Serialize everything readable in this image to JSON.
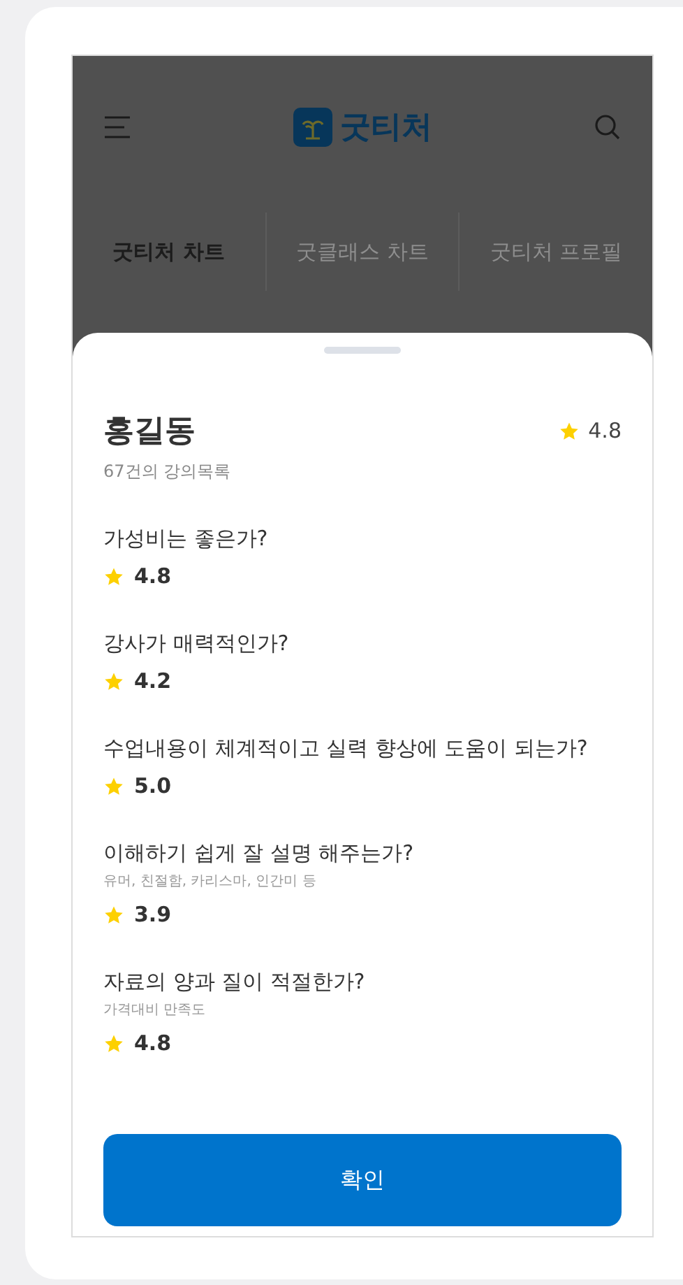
{
  "header": {
    "logo_text": "굿티처"
  },
  "tabs": [
    {
      "label": "굿티처 차트",
      "selected": true
    },
    {
      "label": "굿클래스 차트",
      "selected": false
    },
    {
      "label": "굿티처 프로필",
      "selected": false
    }
  ],
  "sheet": {
    "name": "홍길동",
    "rating": "4.8",
    "subtitle": "67건의 강의목록",
    "questions": [
      {
        "question": "가성비는 좋은가?",
        "score": "4.8"
      },
      {
        "question": "강사가 매력적인가?",
        "score": "4.2"
      },
      {
        "question": "수업내용이 체계적이고 실력 향상에 도움이 되는가?",
        "score": "5.0"
      },
      {
        "question": "이해하기 쉽게 잘 설명 해주는가?",
        "note": "유머, 친절함, 카리스마, 인간미 등",
        "score": "3.9"
      },
      {
        "question": "자료의 양과 질이 적절한가?",
        "note": "가격대비 만족도",
        "score": "4.8"
      }
    ],
    "confirm_button": "확인"
  }
}
